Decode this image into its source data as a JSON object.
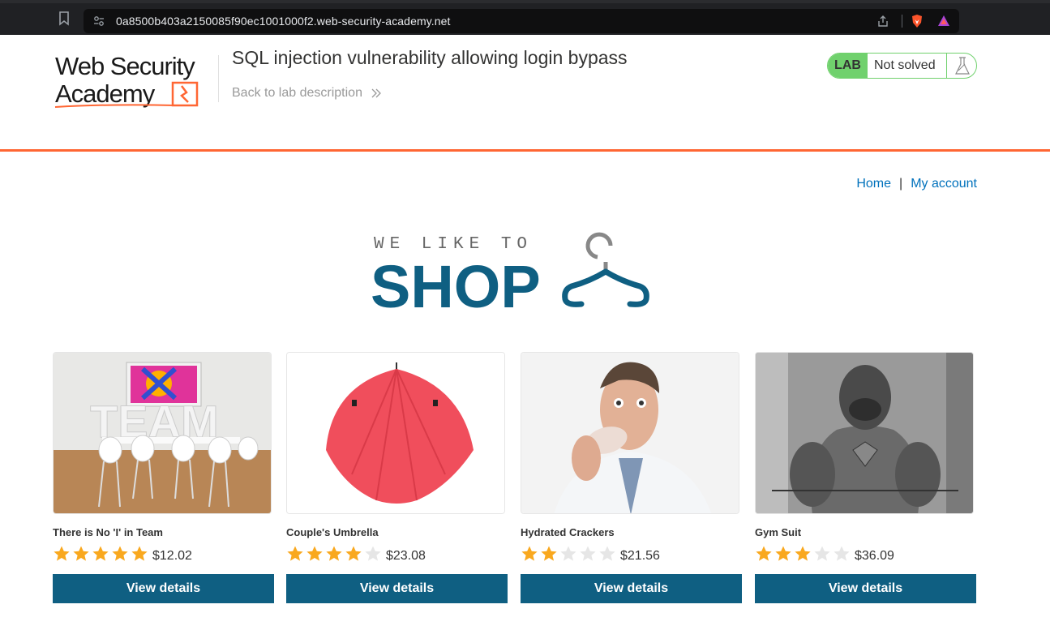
{
  "browser": {
    "url": "0a8500b403a2150085f90ec1001000f2.web-security-academy.net"
  },
  "header": {
    "logo_line1": "Web Security",
    "logo_line2": "Academy",
    "lab_title": "SQL injection vulnerability allowing login bypass",
    "back_link": "Back to lab description",
    "lab_tag": "LAB",
    "lab_status": "Not solved"
  },
  "nav": {
    "home": "Home",
    "separator": "|",
    "account": "My account"
  },
  "banner": {
    "tagline": "WE LIKE TO",
    "word": "SHOP"
  },
  "colors": {
    "accent_orange": "#ff6633",
    "button_blue": "#0f5f82",
    "link_blue": "#0071bc",
    "lab_green": "#70d16d",
    "star_gold": "#f9a81e",
    "star_empty": "#e6e6e6"
  },
  "products": [
    {
      "name": "There is No 'I' in Team",
      "rating": 5,
      "price": "$12.02",
      "button": "View details"
    },
    {
      "name": "Couple's Umbrella",
      "rating": 4,
      "price": "$23.08",
      "button": "View details"
    },
    {
      "name": "Hydrated Crackers",
      "rating": 2,
      "price": "$21.56",
      "button": "View details"
    },
    {
      "name": "Gym Suit",
      "rating": 3,
      "price": "$36.09",
      "button": "View details"
    }
  ]
}
